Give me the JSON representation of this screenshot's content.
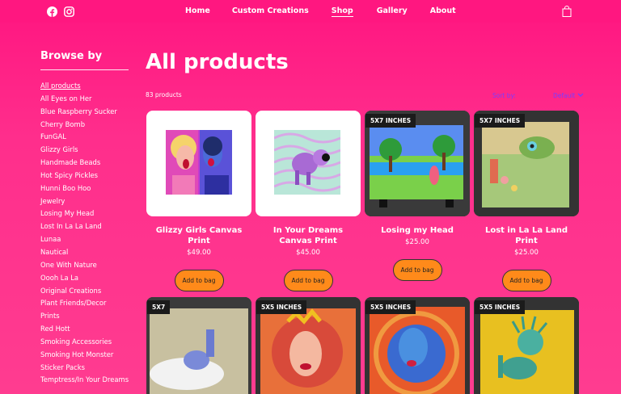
{
  "header": {
    "social": [
      "facebook-icon",
      "instagram-icon"
    ],
    "nav": {
      "home": "Home",
      "custom": "Custom Creations",
      "shop": "Shop",
      "gallery": "Gallery",
      "about": "About"
    }
  },
  "sidebar": {
    "title": "Browse by",
    "items": [
      "All products",
      "All Eyes on Her",
      "Blue Raspberry Sucker",
      "Cherry Bomb",
      "FunGAL",
      "Glizzy Girls",
      "Handmade Beads",
      "Hot Spicy Pickles",
      "Hunni Boo Hoo",
      "Jewelry",
      "Losing My Head",
      "Lost In La La Land",
      "Lunaa",
      "Nautical",
      "One With Nature",
      "Oooh La La",
      "Original Creations",
      "Plant Friends/Decor",
      "Prints",
      "Red Hott",
      "Smoking Accessories",
      "Smoking Hot Monster",
      "Sticker Packs",
      "Temptress/In Your Dreams"
    ]
  },
  "main": {
    "title": "All products",
    "count": "83 products",
    "sort_label": "Sort by:",
    "sort_value": "Default",
    "add_label": "Add to bag"
  },
  "products_row1": [
    {
      "name": "Glizzy Girls Canvas Print",
      "price": "$49.00",
      "badge": ""
    },
    {
      "name": "In Your Dreams Canvas Print",
      "price": "$45.00",
      "badge": ""
    },
    {
      "name": "Losing my Head",
      "price": "$25.00",
      "badge": "5X7 INCHES"
    },
    {
      "name": "Lost in La La Land Print",
      "price": "$25.00",
      "badge": "5X7 INCHES"
    }
  ],
  "products_row2": [
    {
      "badge": "5X7"
    },
    {
      "badge": "5X5 INCHES"
    },
    {
      "badge": "5X5 INCHES"
    },
    {
      "badge": "5X5 INCHES"
    }
  ],
  "colors": {
    "background": "#ff2e8c",
    "button": "#ff8a1a",
    "sort": "#7a3cff"
  }
}
